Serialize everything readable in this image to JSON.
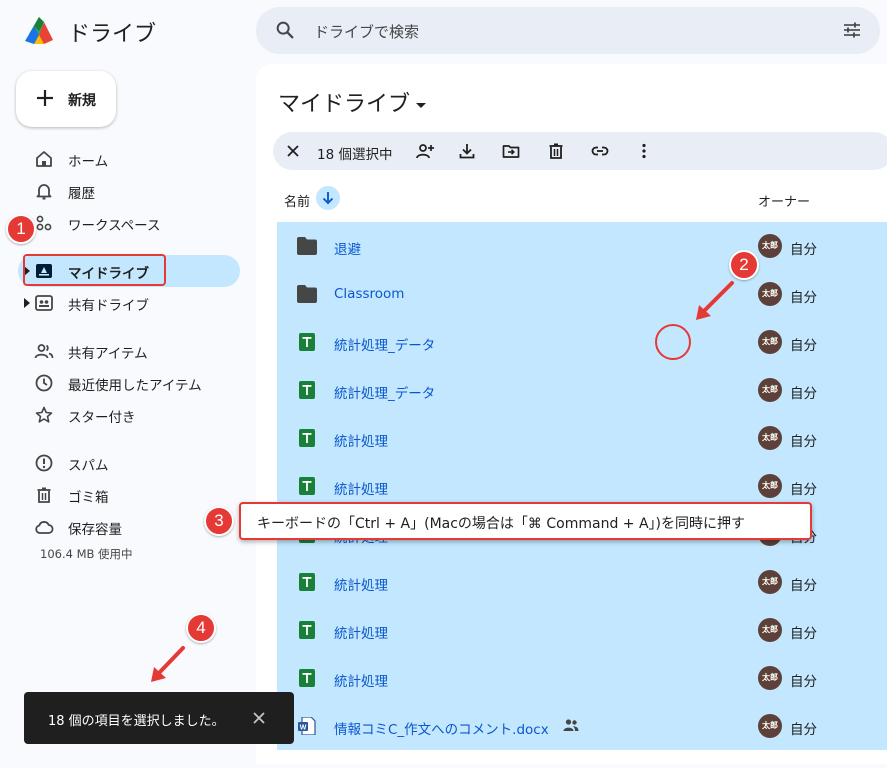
{
  "app": {
    "title": "ドライブ"
  },
  "search": {
    "placeholder": "ドライブで検索"
  },
  "new_button": {
    "label": "新規"
  },
  "sidebar": {
    "items": [
      {
        "label": "ホーム",
        "icon": "home-icon"
      },
      {
        "label": "履歴",
        "icon": "bell-icon"
      },
      {
        "label": "ワークスペース",
        "icon": "workspace-icon"
      },
      {
        "label": "マイドライブ",
        "icon": "my-drive-icon",
        "active": true
      },
      {
        "label": "共有ドライブ",
        "icon": "shared-drive-icon"
      },
      {
        "label": "共有アイテム",
        "icon": "people-icon"
      },
      {
        "label": "最近使用したアイテム",
        "icon": "clock-icon"
      },
      {
        "label": "スター付き",
        "icon": "star-icon"
      },
      {
        "label": "スパム",
        "icon": "spam-icon"
      },
      {
        "label": "ゴミ箱",
        "icon": "trash-icon"
      },
      {
        "label": "保存容量",
        "icon": "cloud-icon"
      }
    ],
    "storage_used": "106.4 MB 使用中"
  },
  "main": {
    "title": "マイドライブ",
    "selection": {
      "count_text": "18 個選択中"
    },
    "columns": {
      "name": "名前",
      "owner": "オーナー"
    },
    "rows": [
      {
        "name": "退避",
        "type": "folder",
        "owner": "自分",
        "avatar": "太郎"
      },
      {
        "name": "Classroom",
        "type": "folder",
        "owner": "自分",
        "avatar": "太郎"
      },
      {
        "name": "統計処理_データ",
        "type": "sheet",
        "owner": "自分",
        "avatar": "太郎"
      },
      {
        "name": "統計処理_データ",
        "type": "sheet",
        "owner": "自分",
        "avatar": "太郎"
      },
      {
        "name": "統計処理",
        "type": "sheet",
        "owner": "自分",
        "avatar": "太郎"
      },
      {
        "name": "統計処理",
        "type": "sheet",
        "owner": "自分",
        "avatar": "太郎"
      },
      {
        "name": "統計処理",
        "type": "sheet",
        "owner": "自分",
        "avatar": "太郎"
      },
      {
        "name": "統計処理",
        "type": "sheet",
        "owner": "自分",
        "avatar": "太郎"
      },
      {
        "name": "統計処理",
        "type": "sheet",
        "owner": "自分",
        "avatar": "太郎"
      },
      {
        "name": "統計処理",
        "type": "sheet",
        "owner": "自分",
        "avatar": "太郎"
      },
      {
        "name": "情報コミC_作文へのコメント.docx",
        "type": "word",
        "owner": "自分",
        "avatar": "太郎",
        "shared": true
      }
    ]
  },
  "annotations": {
    "badges": [
      "1",
      "2",
      "3",
      "4"
    ],
    "callout": "キーボードの「Ctrl + A」(Macの場合は「⌘ Command + A」)を同時に押す",
    "accent_color": "#e53935"
  },
  "toast": {
    "message": "18 個の項目を選択しました。"
  },
  "colors": {
    "selection": "#c2e7ff",
    "link": "#0b57d0",
    "sheet": "#188038",
    "folder": "#444746"
  }
}
